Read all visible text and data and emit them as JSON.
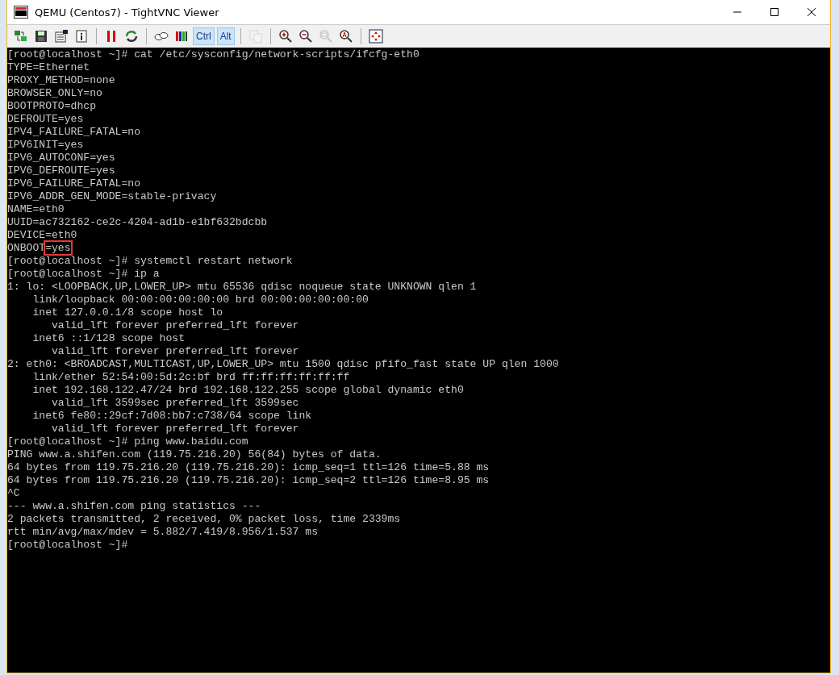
{
  "window": {
    "title": "QEMU (Centos7) - TightVNC Viewer"
  },
  "toolbar": {
    "groups": [
      {
        "buttons": [
          {
            "disabled": false
          },
          {
            "disabled": false
          },
          {
            "disabled": false
          },
          {
            "disabled": false
          }
        ]
      },
      {
        "buttons": [
          {
            "disabled": false
          },
          {
            "disabled": false
          }
        ]
      },
      {
        "buttons": [
          {
            "disabled": false
          },
          {
            "disabled": false
          }
        ],
        "toggles": [
          {
            "label": "Ctrl",
            "selected": true
          },
          {
            "label": "Alt",
            "selected": true
          }
        ]
      },
      {
        "buttons": [
          {
            "disabled": true
          }
        ]
      },
      {
        "buttons": [
          {
            "disabled": false
          },
          {
            "disabled": false
          },
          {
            "disabled": true
          },
          {
            "disabled": false
          }
        ]
      },
      {
        "buttons": [
          {
            "disabled": false
          }
        ]
      }
    ]
  },
  "terminal": {
    "lines": [
      [
        {
          "text": "[root@localhost ~]# cat /etc/sysconfig/network-scripts/ifcfg-eth0",
          "boxed": false
        }
      ],
      [
        {
          "text": "TYPE=Ethernet",
          "boxed": false
        }
      ],
      [
        {
          "text": "PROXY_METHOD=none",
          "boxed": false
        }
      ],
      [
        {
          "text": "BROWSER_ONLY=no",
          "boxed": false
        }
      ],
      [
        {
          "text": "BOOTPROTO=dhcp",
          "boxed": false
        }
      ],
      [
        {
          "text": "DEFROUTE=yes",
          "boxed": false
        }
      ],
      [
        {
          "text": "IPV4_FAILURE_FATAL=no",
          "boxed": false
        }
      ],
      [
        {
          "text": "IPV6INIT=yes",
          "boxed": false
        }
      ],
      [
        {
          "text": "IPV6_AUTOCONF=yes",
          "boxed": false
        }
      ],
      [
        {
          "text": "IPV6_DEFROUTE=yes",
          "boxed": false
        }
      ],
      [
        {
          "text": "IPV6_FAILURE_FATAL=no",
          "boxed": false
        }
      ],
      [
        {
          "text": "IPV6_ADDR_GEN_MODE=stable-privacy",
          "boxed": false
        }
      ],
      [
        {
          "text": "NAME=eth0",
          "boxed": false
        }
      ],
      [
        {
          "text": "UUID=ac732162-ce2c-4204-ad1b-e1bf632bdcbb",
          "boxed": false
        }
      ],
      [
        {
          "text": "DEVICE=eth0",
          "boxed": false
        }
      ],
      [
        {
          "text": "ONBOOT",
          "boxed": false
        },
        {
          "text": "=yes",
          "boxed": true
        }
      ],
      [
        {
          "text": "[root@localhost ~]# systemctl restart network",
          "boxed": false
        }
      ],
      [
        {
          "text": "[root@localhost ~]# ip a",
          "boxed": false
        }
      ],
      [
        {
          "text": "1: lo: <LOOPBACK,UP,LOWER_UP> mtu 65536 qdisc noqueue state UNKNOWN qlen 1",
          "boxed": false
        }
      ],
      [
        {
          "text": "    link/loopback 00:00:00:00:00:00 brd 00:00:00:00:00:00",
          "boxed": false
        }
      ],
      [
        {
          "text": "    inet 127.0.0.1/8 scope host lo",
          "boxed": false
        }
      ],
      [
        {
          "text": "       valid_lft forever preferred_lft forever",
          "boxed": false
        }
      ],
      [
        {
          "text": "    inet6 ::1/128 scope host",
          "boxed": false
        }
      ],
      [
        {
          "text": "       valid_lft forever preferred_lft forever",
          "boxed": false
        }
      ],
      [
        {
          "text": "2: eth0: <BROADCAST,MULTICAST,UP,LOWER_UP> mtu 1500 qdisc pfifo_fast state UP qlen 1000",
          "boxed": false
        }
      ],
      [
        {
          "text": "    link/ether 52:54:00:5d:2c:bf brd ff:ff:ff:ff:ff:ff",
          "boxed": false
        }
      ],
      [
        {
          "text": "    inet 192.168.122.47/24 brd 192.168.122.255 scope global dynamic eth0",
          "boxed": false
        }
      ],
      [
        {
          "text": "       valid_lft 3599sec preferred_lft 3599sec",
          "boxed": false
        }
      ],
      [
        {
          "text": "    inet6 fe80::29cf:7d08:bb7:c738/64 scope link",
          "boxed": false
        }
      ],
      [
        {
          "text": "       valid_lft forever preferred_lft forever",
          "boxed": false
        }
      ],
      [
        {
          "text": "[root@localhost ~]# ping www.baidu.com",
          "boxed": false
        }
      ],
      [
        {
          "text": "PING www.a.shifen.com (119.75.216.20) 56(84) bytes of data.",
          "boxed": false
        }
      ],
      [
        {
          "text": "64 bytes from 119.75.216.20 (119.75.216.20): icmp_seq=1 ttl=126 time=5.88 ms",
          "boxed": false
        }
      ],
      [
        {
          "text": "64 bytes from 119.75.216.20 (119.75.216.20): icmp_seq=2 ttl=126 time=8.95 ms",
          "boxed": false
        }
      ],
      [
        {
          "text": "^C",
          "boxed": false
        }
      ],
      [
        {
          "text": "--- www.a.shifen.com ping statistics ---",
          "boxed": false
        }
      ],
      [
        {
          "text": "2 packets transmitted, 2 received, 0% packet loss, time 2339ms",
          "boxed": false
        }
      ],
      [
        {
          "text": "rtt min/avg/max/mdev = 5.882/7.419/8.956/1.537 ms",
          "boxed": false
        }
      ],
      [
        {
          "text": "[root@localhost ~]#",
          "boxed": false
        }
      ]
    ]
  }
}
